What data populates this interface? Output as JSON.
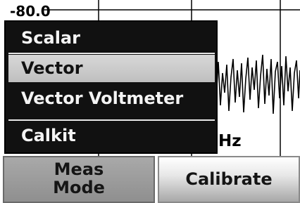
{
  "plot": {
    "scale_label": "-80.0",
    "freq_label": "Hz"
  },
  "menu": {
    "items": [
      {
        "label": "Scalar",
        "selected": false
      },
      {
        "label": "Vector",
        "selected": true
      },
      {
        "label": "Vector Voltmeter",
        "selected": false
      },
      {
        "label": "Calkit",
        "selected": false
      }
    ]
  },
  "softkeys": {
    "meas_mode_line1": "Meas",
    "meas_mode_line2": "Mode",
    "calibrate": "Calibrate"
  },
  "colors": {
    "menu_background": "#111111",
    "menu_text": "#f4f4f4",
    "menu_selected": "#c8c8c8"
  }
}
